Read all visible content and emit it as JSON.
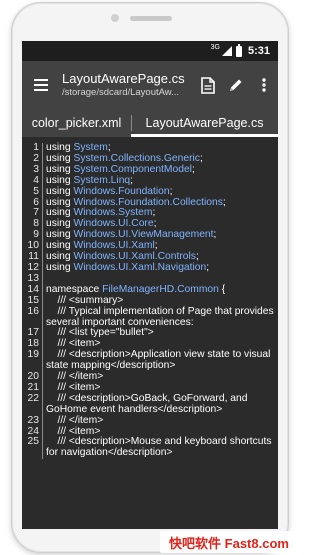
{
  "status_bar": {
    "network": "3G",
    "time": "5:31"
  },
  "app_bar": {
    "title": "LayoutAwarePage.cs",
    "subtitle": "/storage/sdcard/LayoutAw..."
  },
  "tabs": [
    {
      "label": "color_picker.xml",
      "selected": false
    },
    {
      "label": "LayoutAwarePage.cs",
      "selected": true
    }
  ],
  "code_lines": [
    {
      "n": "1",
      "parts": [
        [
          "kw",
          "using "
        ],
        [
          "ty",
          "System"
        ],
        [
          "kw",
          ";"
        ]
      ]
    },
    {
      "n": "2",
      "parts": [
        [
          "kw",
          "using "
        ],
        [
          "ty",
          "System.Collections.Generic"
        ],
        [
          "kw",
          ";"
        ]
      ]
    },
    {
      "n": "3",
      "parts": [
        [
          "kw",
          "using "
        ],
        [
          "ty",
          "System.ComponentModel"
        ],
        [
          "kw",
          ";"
        ]
      ]
    },
    {
      "n": "4",
      "parts": [
        [
          "kw",
          "using "
        ],
        [
          "ty",
          "System.Linq"
        ],
        [
          "kw",
          ";"
        ]
      ]
    },
    {
      "n": "5",
      "parts": [
        [
          "kw",
          "using "
        ],
        [
          "ty",
          "Windows.Foundation"
        ],
        [
          "kw",
          ";"
        ]
      ]
    },
    {
      "n": "6",
      "parts": [
        [
          "kw",
          "using "
        ],
        [
          "ty",
          "Windows.Foundation.Collections"
        ],
        [
          "kw",
          ";"
        ]
      ]
    },
    {
      "n": "7",
      "parts": [
        [
          "kw",
          "using "
        ],
        [
          "ty",
          "Windows.System"
        ],
        [
          "kw",
          ";"
        ]
      ]
    },
    {
      "n": "8",
      "parts": [
        [
          "kw",
          "using "
        ],
        [
          "ty",
          "Windows.UI.Core"
        ],
        [
          "kw",
          ";"
        ]
      ]
    },
    {
      "n": "9",
      "parts": [
        [
          "kw",
          "using "
        ],
        [
          "ty",
          "Windows.UI.ViewManagement"
        ],
        [
          "kw",
          ";"
        ]
      ]
    },
    {
      "n": "10",
      "parts": [
        [
          "kw",
          "using "
        ],
        [
          "ty",
          "Windows.UI.Xaml"
        ],
        [
          "kw",
          ";"
        ]
      ]
    },
    {
      "n": "11",
      "parts": [
        [
          "kw",
          "using "
        ],
        [
          "ty",
          "Windows.UI.Xaml.Controls"
        ],
        [
          "kw",
          ";"
        ]
      ]
    },
    {
      "n": "12",
      "parts": [
        [
          "kw",
          "using "
        ],
        [
          "ty",
          "Windows.UI.Xaml.Navigation"
        ],
        [
          "kw",
          ";"
        ]
      ]
    },
    {
      "n": "13",
      "parts": [
        [
          "kw",
          ""
        ]
      ]
    },
    {
      "n": "14",
      "parts": [
        [
          "kw",
          "namespace "
        ],
        [
          "ty",
          "FileManagerHD.Common"
        ],
        [
          "kw",
          " {"
        ]
      ]
    },
    {
      "n": "15",
      "parts": [
        [
          "kw",
          "    /// <summary>"
        ]
      ]
    },
    {
      "n": "16",
      "parts": [
        [
          "kw",
          "    /// Typical implementation of Page that provides several important conveniences:"
        ]
      ]
    },
    {
      "n": "17",
      "parts": [
        [
          "kw",
          "    /// <list type=\"bullet\">"
        ]
      ]
    },
    {
      "n": "18",
      "parts": [
        [
          "kw",
          "    /// <item>"
        ]
      ]
    },
    {
      "n": "19",
      "parts": [
        [
          "kw",
          "    /// <description>Application view state to visual state mapping</description>"
        ]
      ]
    },
    {
      "n": "20",
      "parts": [
        [
          "kw",
          "    /// </item>"
        ]
      ]
    },
    {
      "n": "21",
      "parts": [
        [
          "kw",
          "    /// <item>"
        ]
      ]
    },
    {
      "n": "22",
      "parts": [
        [
          "kw",
          "    /// <description>GoBack, GoForward, and GoHome event handlers</description>"
        ]
      ]
    },
    {
      "n": "23",
      "parts": [
        [
          "kw",
          "    /// </item>"
        ]
      ]
    },
    {
      "n": "24",
      "parts": [
        [
          "kw",
          "    /// <item>"
        ]
      ]
    },
    {
      "n": "25",
      "parts": [
        [
          "kw",
          "    /// <description>Mouse and keyboard shortcuts for navigation</description>"
        ]
      ]
    }
  ],
  "watermark": "快吧软件 Fast8.com",
  "icons": {
    "menu": "hamburger-menu-icon",
    "file": "file-document-icon",
    "edit": "pencil-icon",
    "more": "more-vertical-icon"
  },
  "colors": {
    "app_bar": "#424242",
    "editor_bg": "#2b2b2b",
    "type_highlight": "#7fb4ff"
  }
}
